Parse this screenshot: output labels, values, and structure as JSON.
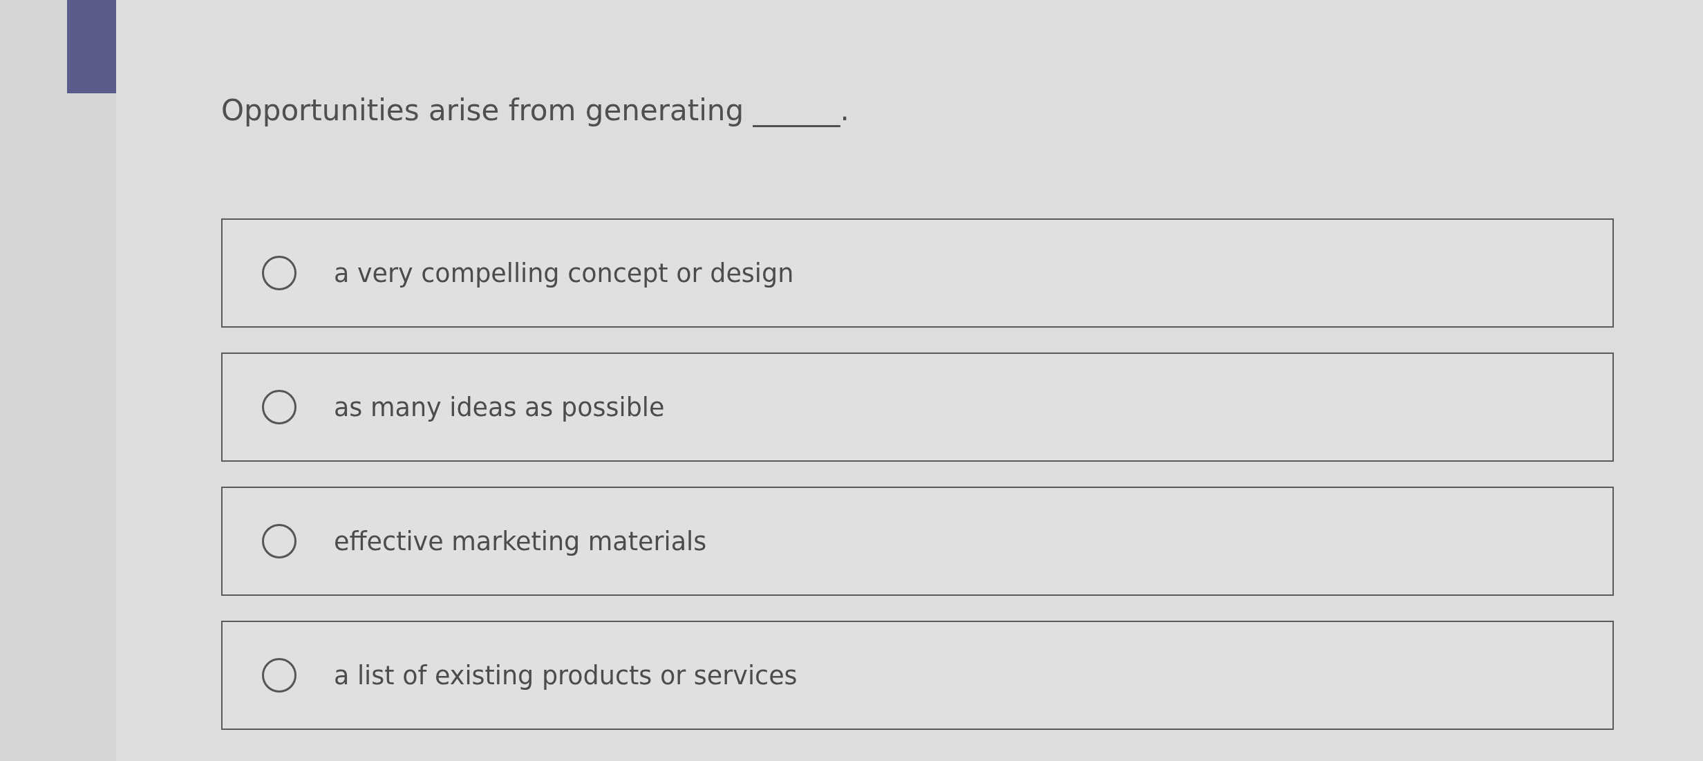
{
  "question": {
    "text": "Opportunities arise from generating ______."
  },
  "options": [
    {
      "label": "a very compelling concept or design",
      "selected": false
    },
    {
      "label": "as many ideas as possible",
      "selected": false
    },
    {
      "label": "effective marketing materials",
      "selected": false
    },
    {
      "label": "a list of existing products or services",
      "selected": false
    }
  ]
}
